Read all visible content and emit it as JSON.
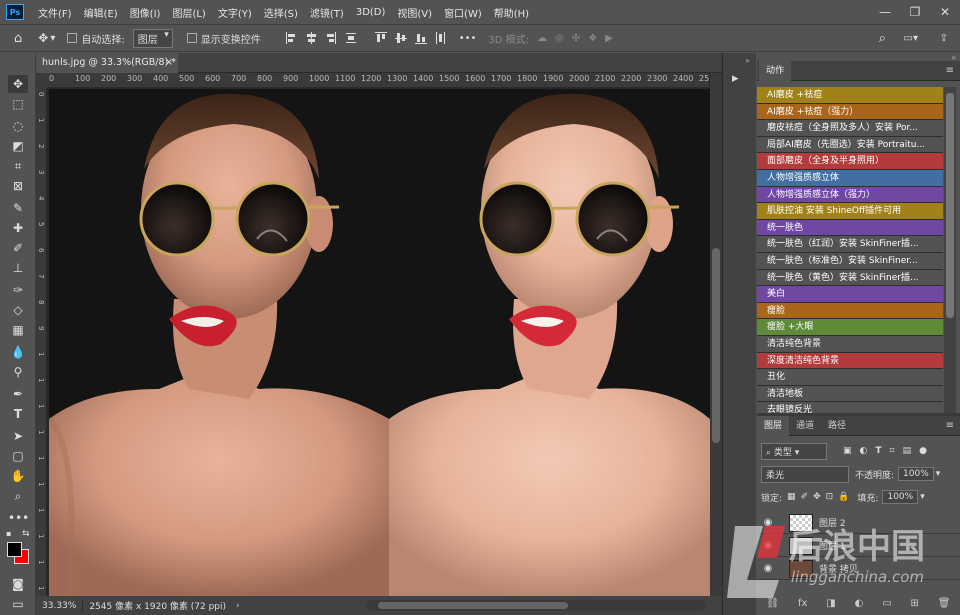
{
  "menubar": {
    "logo": "Ps",
    "items": [
      "文件(F)",
      "编辑(E)",
      "图像(I)",
      "图层(L)",
      "文字(Y)",
      "选择(S)",
      "滤镜(T)",
      "3D(D)",
      "视图(V)",
      "窗口(W)",
      "帮助(H)"
    ],
    "win_min": "—",
    "win_max": "❐",
    "win_close": "✕"
  },
  "options": {
    "auto_select_label": "自动选择:",
    "auto_select_value": "图层",
    "show_transform_label": "显示变换控件",
    "more": "•••",
    "mode_3d_label": "3D 模式:"
  },
  "document": {
    "tab_title": "hunls.jpg @ 33.3%(RGB/8) *",
    "tab_close": "×",
    "zoom": "33.33%",
    "size_info": "2545 像素 x 1920 像素 (72 ppi)"
  },
  "rulers": {
    "top": [
      "0",
      "100",
      "200",
      "300",
      "400",
      "500",
      "600",
      "700",
      "800",
      "900",
      "1000",
      "1100",
      "1200",
      "1300",
      "1400",
      "1500",
      "1600",
      "1700",
      "1800",
      "1900",
      "2000",
      "2100",
      "2200",
      "2300",
      "2400",
      "2500"
    ],
    "left": [
      "0",
      "1",
      "2",
      "3",
      "4",
      "5",
      "6",
      "7",
      "8",
      "9",
      "1",
      "1",
      "1",
      "1",
      "1",
      "1",
      "1",
      "1",
      "1",
      "1"
    ]
  },
  "actions_panel": {
    "tab": "动作",
    "items": [
      {
        "label": "AI磨皮 +祛痘",
        "color": "#a18219"
      },
      {
        "label": "AI磨皮 +祛痘（强力）",
        "color": "#a9651b"
      },
      {
        "label": "磨皮祛痘（全身照及多人）安装 Por...",
        "color": "#535353"
      },
      {
        "label": "局部AI磨皮（先圈选）安装 Portraitu...",
        "color": "#535353"
      },
      {
        "label": "面部磨皮（全身及半身照用）",
        "color": "#b23b3b"
      },
      {
        "label": "人物增强质感立体",
        "color": "#436ea3"
      },
      {
        "label": "人物增强质感立体（强力）",
        "color": "#7048a3"
      },
      {
        "label": "肌肤控油 安装 ShineOff插件可用",
        "color": "#a18219"
      },
      {
        "label": "统一肤色",
        "color": "#7048a3"
      },
      {
        "label": "统一肤色（红润）安装 SkinFiner插...",
        "color": "#535353"
      },
      {
        "label": "统一肤色（标准色）安装 SkinFiner...",
        "color": "#535353"
      },
      {
        "label": "统一肤色（黄色）安装 SkinFiner插...",
        "color": "#535353"
      },
      {
        "label": "美白",
        "color": "#7048a3"
      },
      {
        "label": "瘦脸",
        "color": "#a9651b"
      },
      {
        "label": "瘦脸 +大眼",
        "color": "#5e8a3a"
      },
      {
        "label": "清洁纯色背景",
        "color": "#535353"
      },
      {
        "label": "深度清洁纯色背景",
        "color": "#b23b3b"
      },
      {
        "label": "丑化",
        "color": "#535353"
      },
      {
        "label": "清洁地板",
        "color": "#535353"
      },
      {
        "label": "去眼镜反光",
        "color": "#535353"
      }
    ]
  },
  "layers_panel": {
    "tabs": [
      "图层",
      "通道",
      "路径"
    ],
    "filter_label": "类型",
    "blend_mode": "柔光",
    "opacity_label": "不透明度:",
    "opacity": "100%",
    "lock_label": "锁定:",
    "fill_label": "填充:",
    "fill": "100%",
    "layers": [
      "图层 2",
      "图层 1",
      "背景 拷贝"
    ]
  },
  "watermark": {
    "cn": "后浪中国",
    "en": "lingganchina.com"
  },
  "colors": {
    "accent_fg": "#000000",
    "accent_bg": "#ff0000"
  }
}
